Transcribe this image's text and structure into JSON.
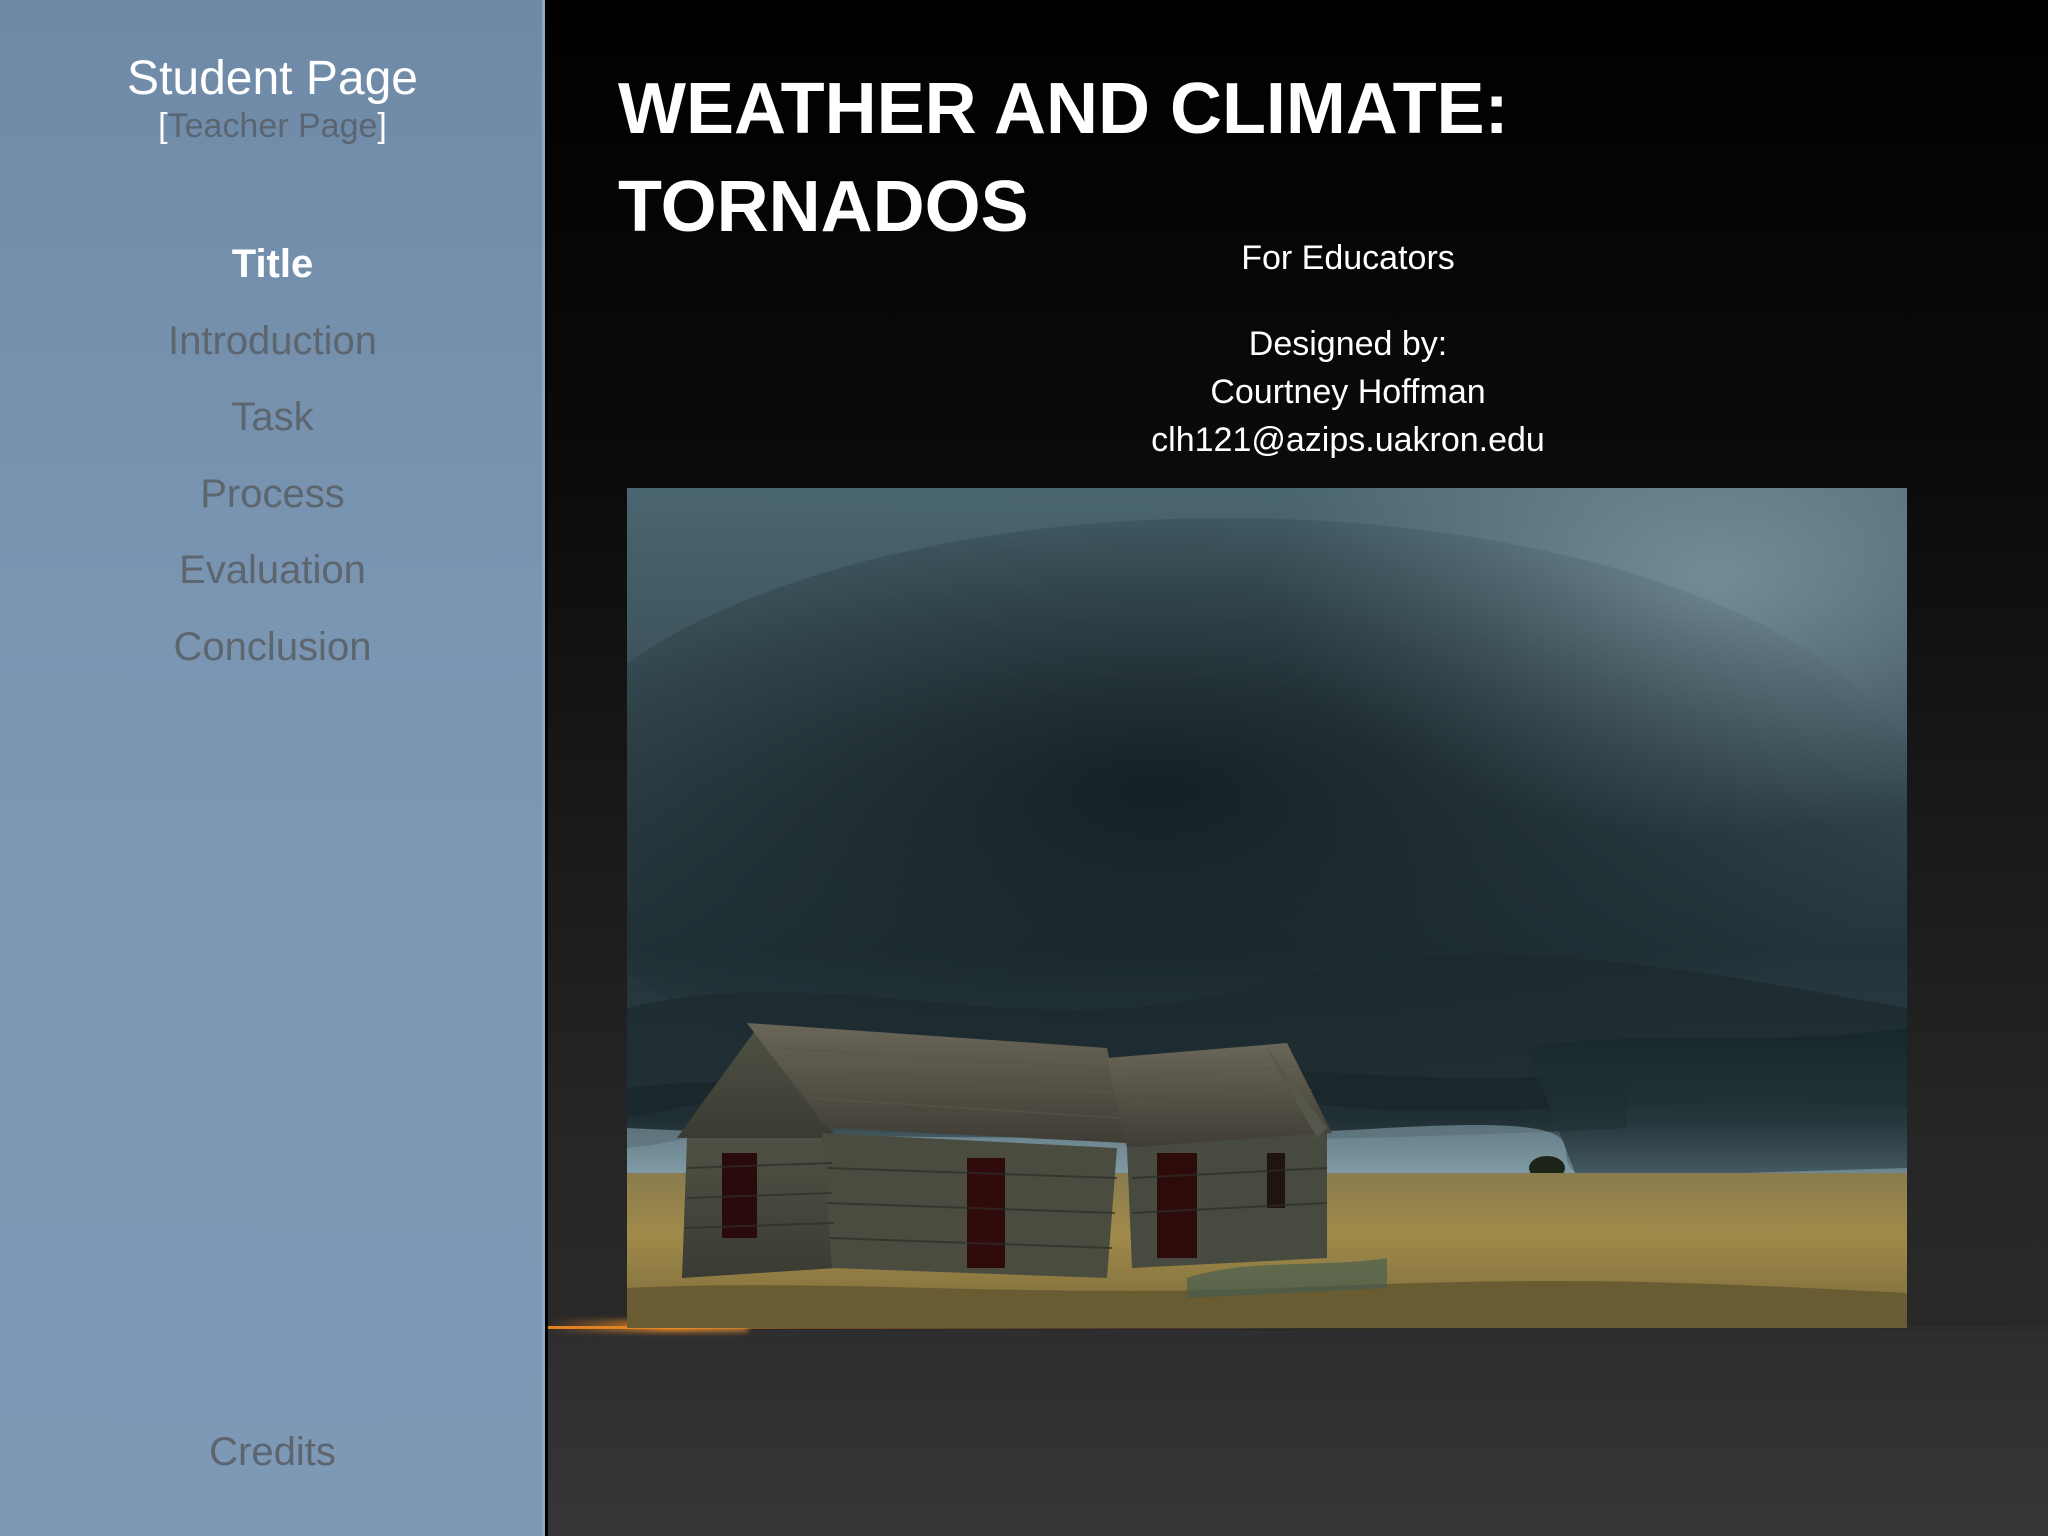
{
  "sidebar": {
    "student_page": "Student Page",
    "teacher_bracket_open": "[",
    "teacher_page": "Teacher Page",
    "teacher_bracket_close": "]",
    "nav": [
      {
        "label": "Title",
        "active": true
      },
      {
        "label": "Introduction"
      },
      {
        "label": "Task"
      },
      {
        "label": "Process"
      },
      {
        "label": "Evaluation"
      },
      {
        "label": "Conclusion"
      }
    ],
    "credits": "Credits"
  },
  "main": {
    "title_line1": "WEATHER AND CLIMATE:",
    "title_line2": "TORNADOS",
    "for_educators": "For Educators",
    "designed_by": "Designed by:",
    "author": "Courtney Hoffman",
    "email": "clh121@azips.uakron.edu"
  },
  "colors": {
    "sidebar": "#7b97b4",
    "active_nav": "#ffffff",
    "inactive_nav": "#5d656e",
    "background": "#000000",
    "accent_glow": "#ff8c1e"
  }
}
